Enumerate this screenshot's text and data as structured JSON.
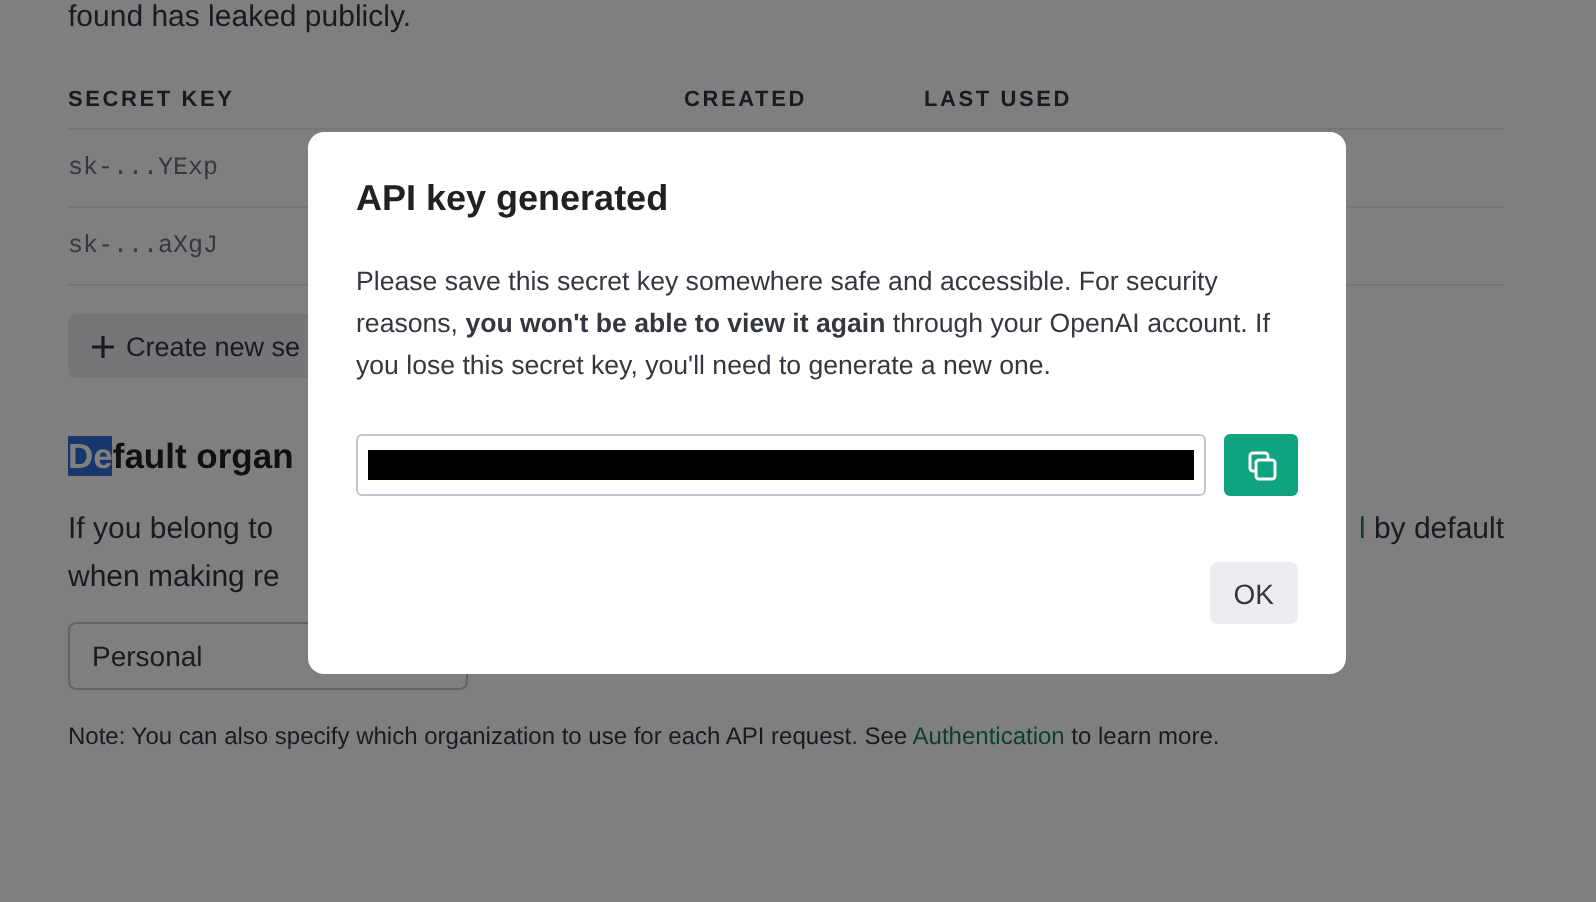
{
  "intro_fragment": "found has leaked publicly.",
  "keys_table": {
    "columns": [
      "SECRET KEY",
      "CREATED",
      "LAST USED"
    ],
    "rows": [
      {
        "key": "sk-...YExp"
      },
      {
        "key": "sk-...aXgJ"
      }
    ]
  },
  "create_button": {
    "label": "Create new se"
  },
  "org_section": {
    "heading": {
      "selected_text": "De",
      "text": "fault organ"
    },
    "para_line_1": "If you belong to",
    "para_link_fragment": "l",
    "para_line_1_end": "by default",
    "para_line_2": "when making re",
    "select": {
      "value": "Personal"
    },
    "note": {
      "before": "Note: You can also specify which organization to use for each API request. See ",
      "link": "Authentication",
      "after": " to learn more."
    }
  },
  "modal": {
    "title": "API key generated",
    "body": "Please save this secret key somewhere safe and accessible. For security reasons, **you won't be able to view it again** through your OpenAI account. If you lose this secret key, you'll need to generate a new one.",
    "key_field": {
      "redacted": true
    },
    "ok_button": "OK"
  }
}
